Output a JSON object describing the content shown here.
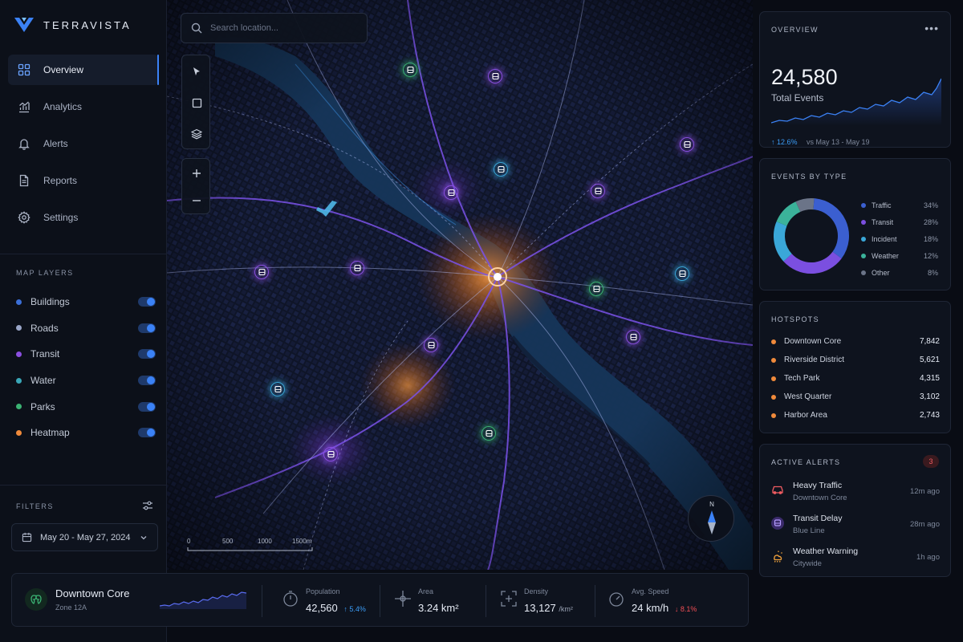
{
  "app": {
    "brand": "TERRAVISTA"
  },
  "sidebar": {
    "nav": [
      {
        "label": "Overview",
        "icon": "grid-icon",
        "active": true
      },
      {
        "label": "Analytics",
        "icon": "bar-chart-icon",
        "active": false
      },
      {
        "label": "Alerts",
        "icon": "bell-icon",
        "active": false
      },
      {
        "label": "Reports",
        "icon": "document-icon",
        "active": false
      },
      {
        "label": "Settings",
        "icon": "gear-icon",
        "active": false
      }
    ],
    "layers_title": "MAP LAYERS",
    "layers": [
      {
        "label": "Buildings",
        "color": "#3b6fd8",
        "on": true
      },
      {
        "label": "Roads",
        "color": "#9aa6c8",
        "on": true
      },
      {
        "label": "Transit",
        "color": "#8b4fe0",
        "on": true
      },
      {
        "label": "Water",
        "color": "#3aa7b8",
        "on": true
      },
      {
        "label": "Parks",
        "color": "#3bb273",
        "on": true
      },
      {
        "label": "Heatmap",
        "color": "#f08a3b",
        "on": true
      }
    ],
    "filters_title": "FILTERS",
    "date_range": "May 20 - May 27, 2024"
  },
  "map": {
    "search_placeholder": "Search location...",
    "scale_labels": [
      "0",
      "500",
      "1000",
      "1500m"
    ],
    "compass_label": "N"
  },
  "bottom": {
    "zone_name": "Downtown Core",
    "zone_sub": "Zone 12A",
    "stats": {
      "population": {
        "label": "Population",
        "value": "42,560",
        "delta": "↑ 5.4%"
      },
      "area": {
        "label": "Area",
        "value": "3.24 km²"
      },
      "density": {
        "label": "Density",
        "value": "13,127",
        "unit": "/km²"
      },
      "speed": {
        "label": "Avg. Speed",
        "value": "24 km/h",
        "delta": "↓ 8.1%"
      }
    }
  },
  "overview": {
    "title": "OVERVIEW",
    "more": "•••",
    "total": "24,580",
    "total_label": "Total Events",
    "delta": "↑ 12.6%",
    "range": "vs May 13 - May 19"
  },
  "events_by_type": {
    "title": "EVENTS BY TYPE",
    "items": [
      {
        "label": "Traffic",
        "value": "34%",
        "color": "#3b5fd0"
      },
      {
        "label": "Transit",
        "value": "28%",
        "color": "#7b4fe0"
      },
      {
        "label": "Incident",
        "value": "18%",
        "color": "#3aa7d8"
      },
      {
        "label": "Weather",
        "value": "12%",
        "color": "#3bb29a"
      },
      {
        "label": "Other",
        "value": "8%",
        "color": "#6b7488"
      }
    ]
  },
  "chart_data": {
    "type": "pie",
    "categories": [
      "Traffic",
      "Transit",
      "Incident",
      "Weather",
      "Other"
    ],
    "values": [
      34,
      28,
      18,
      12,
      8
    ],
    "title": "EVENTS BY TYPE"
  },
  "hotspots": {
    "title": "HOTSPOTS",
    "items": [
      {
        "name": "Downtown Core",
        "value": "7,842"
      },
      {
        "name": "Riverside District",
        "value": "5,621"
      },
      {
        "name": "Tech Park",
        "value": "4,315"
      },
      {
        "name": "West Quarter",
        "value": "3,102"
      },
      {
        "name": "Harbor Area",
        "value": "2,743"
      }
    ]
  },
  "alerts": {
    "title": "ACTIVE ALERTS",
    "count": "3",
    "items": [
      {
        "title": "Heavy Traffic",
        "sub": "Downtown Core",
        "time": "12m ago",
        "icon": "car-icon",
        "color": "#ef5b61"
      },
      {
        "title": "Transit Delay",
        "sub": "Blue Line",
        "time": "28m ago",
        "icon": "bus-icon",
        "color": "#8b6cf0"
      },
      {
        "title": "Weather Warning",
        "sub": "Citywide",
        "time": "1h ago",
        "icon": "cloud-sun-icon",
        "color": "#f0a03b"
      }
    ]
  }
}
